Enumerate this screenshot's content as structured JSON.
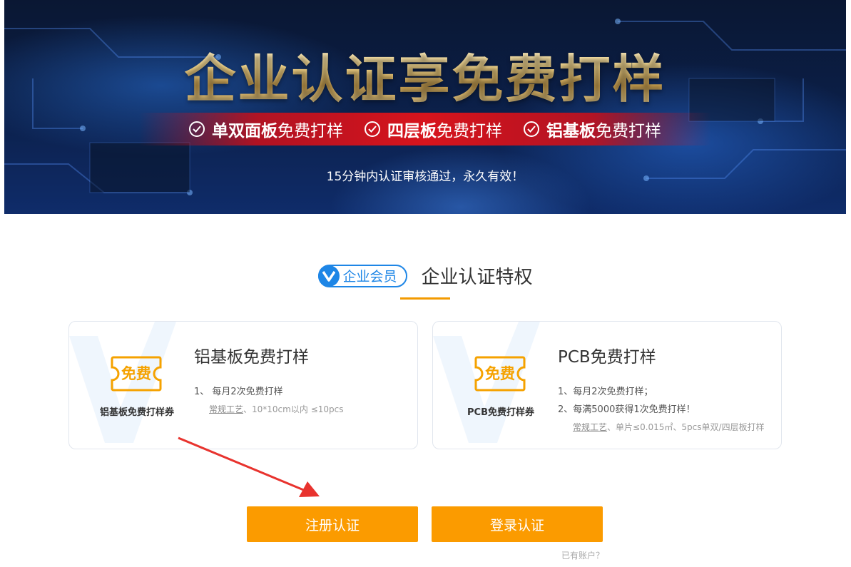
{
  "banner": {
    "title": "企业认证享免费打样",
    "features": [
      {
        "bold": "单双面板",
        "normal": "免费打样"
      },
      {
        "bold": "四层板",
        "normal": "免费打样"
      },
      {
        "bold": "铝基板",
        "normal": "免费打样"
      }
    ],
    "subtitle": "15分钟内认证审核通过，永久有效！"
  },
  "section": {
    "badge": "企业会员",
    "title": "企业认证特权"
  },
  "cards": [
    {
      "coupon": "免费",
      "coupon_label": "铝基板免费打样券",
      "title": "铝基板免费打样",
      "lines": [
        "1、 每月2次免费打样"
      ],
      "note_link": "常规工艺",
      "note_text": "、10*10cm以内 ≤10pcs"
    },
    {
      "coupon": "免费",
      "coupon_label": "PCB免费打样券",
      "title": "PCB免费打样",
      "lines": [
        "1、每月2次免费打样；",
        "2、每满5000获得1次免费打样！"
      ],
      "note_link": "常规工艺",
      "note_text": "、单片≤0.015㎡、5pcs单双/四层板打样"
    }
  ],
  "buttons": {
    "register": "注册认证",
    "login": "登录认证"
  },
  "hint": "已有账户？",
  "colors": {
    "accent_orange": "#fb9b00",
    "brand_blue": "#1e86e6",
    "ribbon_red": "#d7141d",
    "arrow_red": "#e8332e"
  },
  "icons": {
    "check": "check-circle-icon",
    "vip": "v-logo-icon",
    "coupon": "coupon-ticket-icon"
  }
}
